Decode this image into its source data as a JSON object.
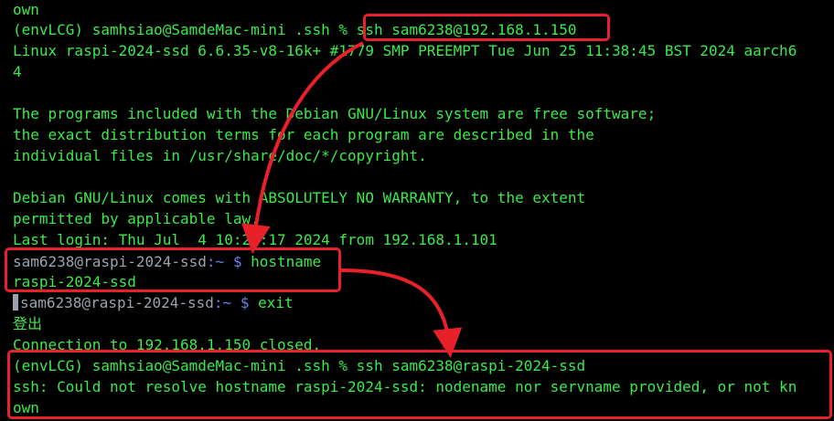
{
  "terminal": {
    "lines": [
      "own",
      "(envLCG) samhsiao@SamdeMac-mini .ssh % ssh sam6238@192.168.1.150",
      "Linux raspi-2024-ssd 6.6.35-v8-16k+ #1779 SMP PREEMPT Tue Jun 25 11:38:45 BST 2024 aarch6",
      "4",
      "",
      "The programs included with the Debian GNU/Linux system are free software;",
      "the exact distribution terms for each program are described in the",
      "individual files in /usr/share/doc/*/copyright.",
      "",
      "Debian GNU/Linux comes with ABSOLUTELY NO WARRANTY, to the extent",
      "permitted by applicable law.",
      "Last login: Thu Jul  4 10:24:17 2024 from 192.168.1.101"
    ],
    "prompt1": {
      "userhost": "sam6238@raspi-2024-ssd",
      "path": ":~ $ ",
      "command": "hostname"
    },
    "hostname_output": "raspi-2024-ssd",
    "prompt2": {
      "userhost": "sam6238@raspi-2024-ssd",
      "path": ":~ $ ",
      "command": "exit"
    },
    "logout_text": "登出",
    "connection_closed": "Connection to 192.168.1.150 closed.",
    "final_command": "(envLCG) samhsiao@SamdeMac-mini .ssh % ssh sam6238@raspi-2024-ssd",
    "error_line1": "ssh: Could not resolve hostname raspi-2024-ssd: nodename nor servname provided, or not kn",
    "error_line2": "own"
  },
  "colors": {
    "background": "#000000",
    "text_green": "#3be94a",
    "user_host_gray": "#9aa3ad",
    "path_blue": "#6a82e8",
    "annotation_red": "#e8202a"
  }
}
